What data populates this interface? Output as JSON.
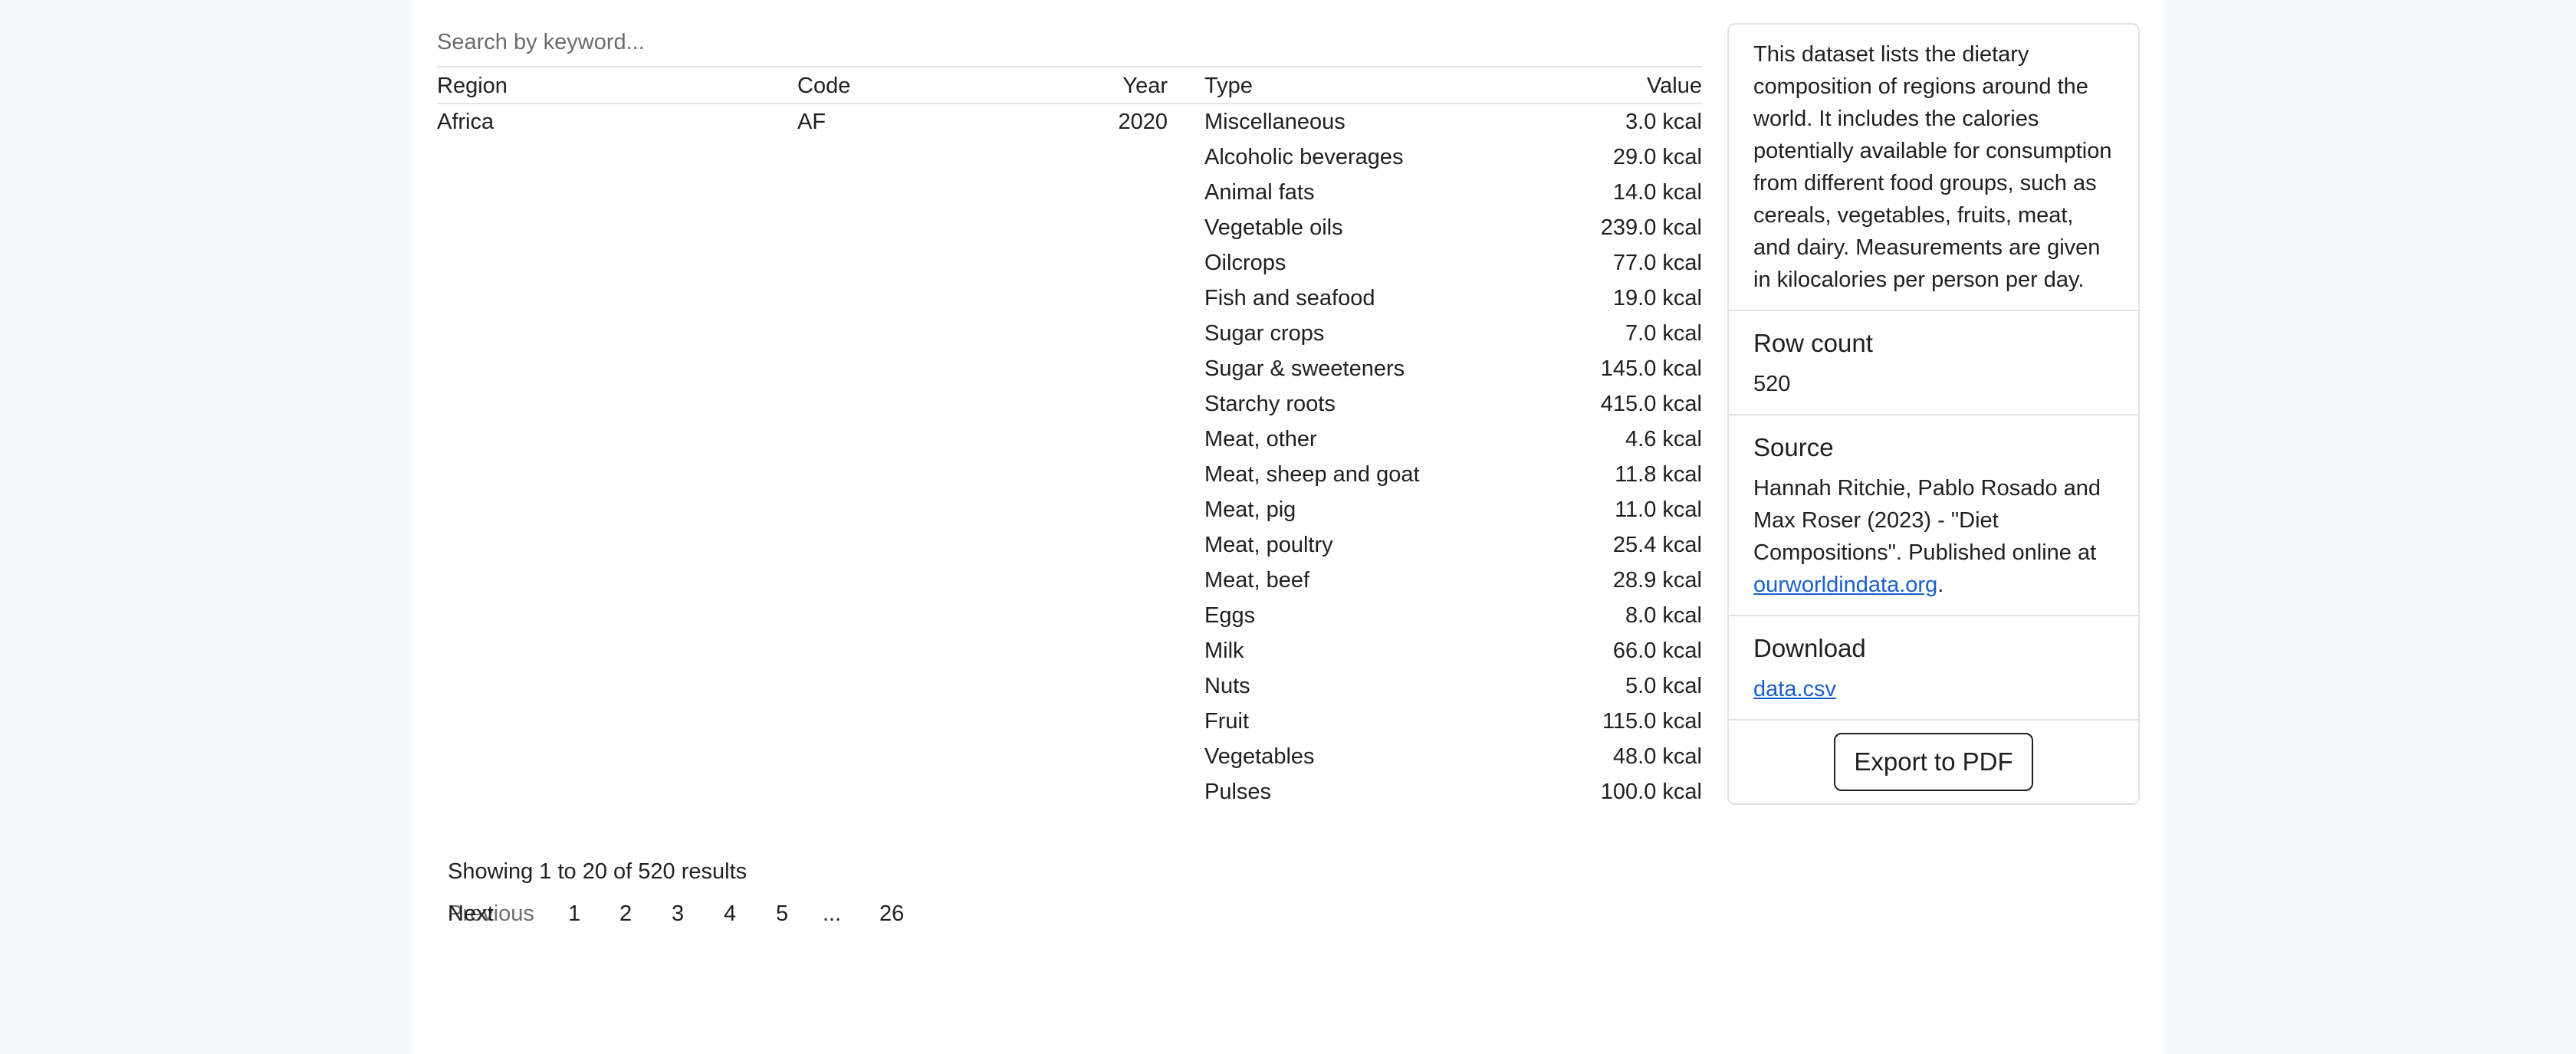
{
  "search": {
    "placeholder": "Search by keyword..."
  },
  "table": {
    "headers": {
      "region": "Region",
      "code": "Code",
      "year": "Year",
      "type": "Type",
      "value": "Value"
    },
    "first_row": {
      "region": "Africa",
      "code": "AF",
      "year": "2020"
    },
    "rows": [
      {
        "type": "Miscellaneous",
        "value": "3.0 kcal"
      },
      {
        "type": "Alcoholic beverages",
        "value": "29.0 kcal"
      },
      {
        "type": "Animal fats",
        "value": "14.0 kcal"
      },
      {
        "type": "Vegetable oils",
        "value": "239.0 kcal"
      },
      {
        "type": "Oilcrops",
        "value": "77.0 kcal"
      },
      {
        "type": "Fish and seafood",
        "value": "19.0 kcal"
      },
      {
        "type": "Sugar crops",
        "value": "7.0 kcal"
      },
      {
        "type": "Sugar & sweeteners",
        "value": "145.0 kcal"
      },
      {
        "type": "Starchy roots",
        "value": "415.0 kcal"
      },
      {
        "type": "Meat, other",
        "value": "4.6 kcal"
      },
      {
        "type": "Meat, sheep and goat",
        "value": "11.8 kcal"
      },
      {
        "type": "Meat, pig",
        "value": "11.0 kcal"
      },
      {
        "type": "Meat, poultry",
        "value": "25.4 kcal"
      },
      {
        "type": "Meat, beef",
        "value": "28.9 kcal"
      },
      {
        "type": "Eggs",
        "value": "8.0 kcal"
      },
      {
        "type": "Milk",
        "value": "66.0 kcal"
      },
      {
        "type": "Nuts",
        "value": "5.0 kcal"
      },
      {
        "type": "Fruit",
        "value": "115.0 kcal"
      },
      {
        "type": "Vegetables",
        "value": "48.0 kcal"
      },
      {
        "type": "Pulses",
        "value": "100.0 kcal"
      }
    ]
  },
  "pagination": {
    "summary": "Showing 1 to 20 of 520 results",
    "previous": "Previous",
    "pages": [
      "1",
      "2",
      "3",
      "4",
      "5",
      "...",
      "26"
    ],
    "next": "Next"
  },
  "sidebar": {
    "description": "This dataset lists the dietary composition of regions around the world. It includes the calories potentially available for consumption from different food groups, such as cereals, vegetables, fruits, meat, and dairy. Measurements are given in kilocalories per person per day.",
    "row_count_title": "Row count",
    "row_count": "520",
    "source_title": "Source",
    "source_text": "Hannah Ritchie, Pablo Rosado and Max Roser (2023) - \"Diet Compositions\". Published online at ",
    "source_link": "ourworldindata.org",
    "source_end": ".",
    "download_title": "Download",
    "download_link": "data.csv",
    "export_label": "Export to PDF"
  },
  "colors": {
    "page_bg": "#f4f6fd",
    "link": "#1a5fd1",
    "border": "#e2e2e2"
  }
}
